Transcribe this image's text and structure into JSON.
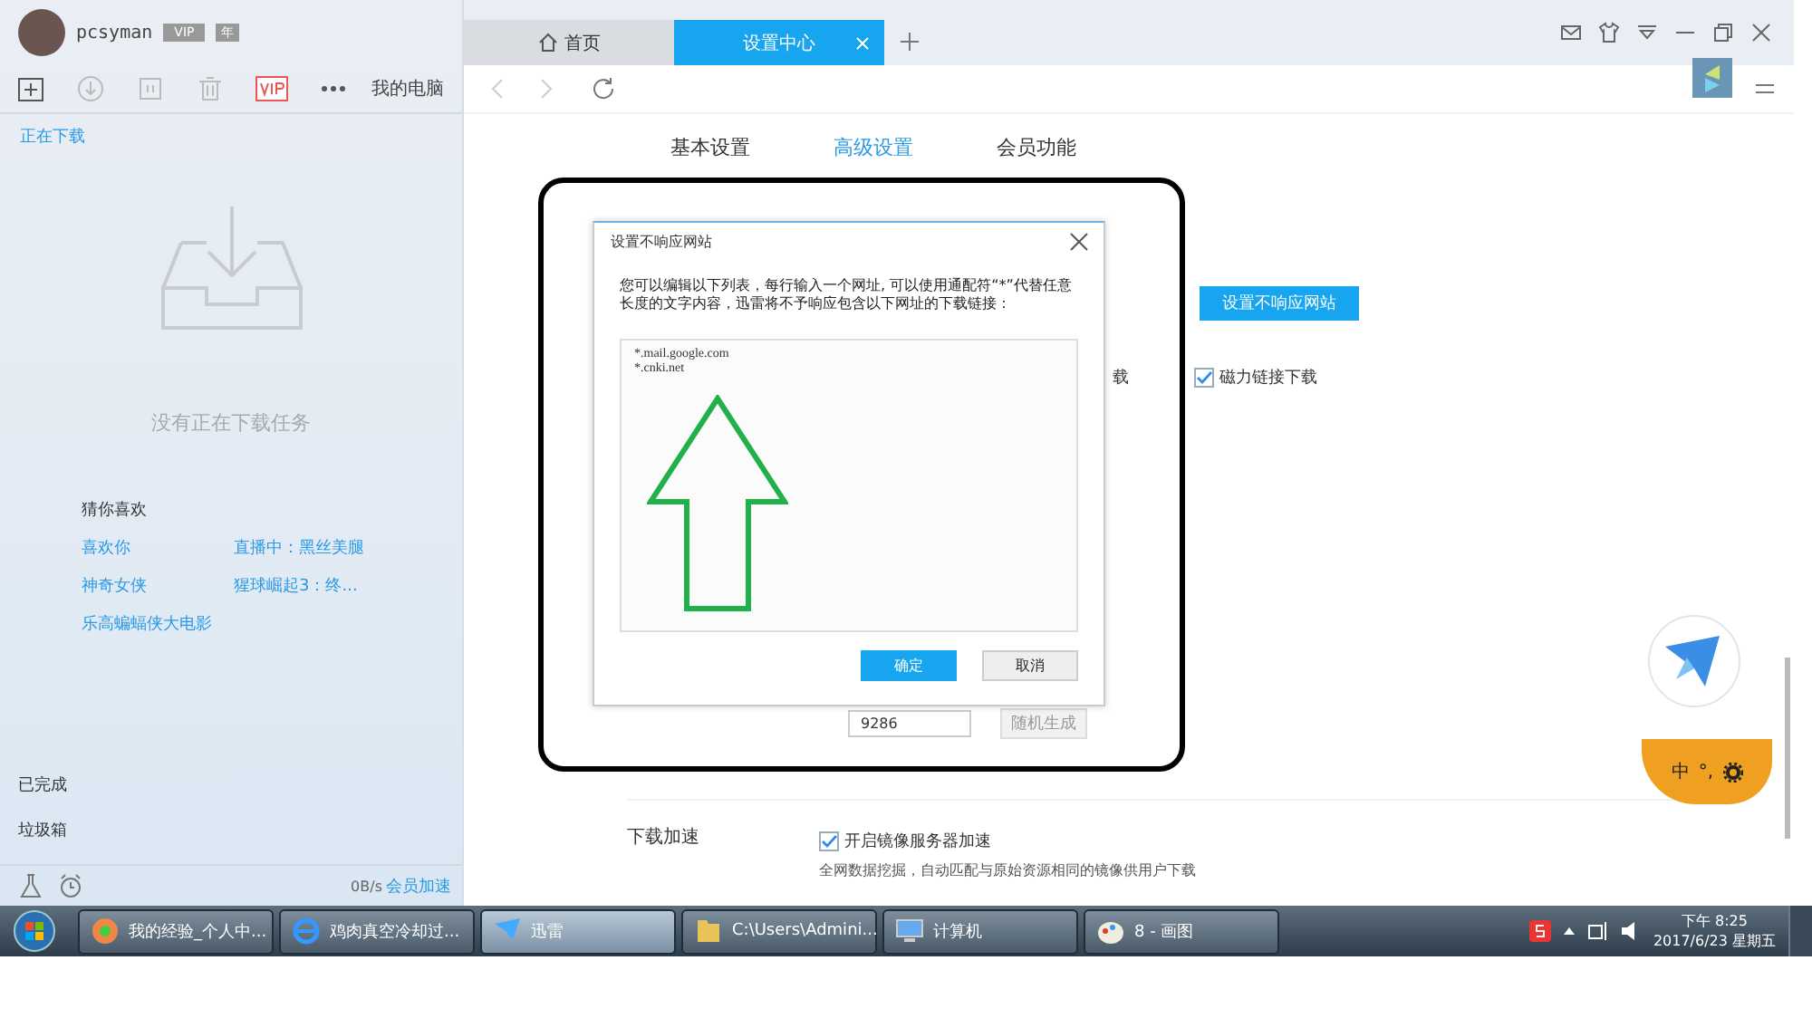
{
  "user": {
    "name": "pcsyman",
    "badges": [
      "VIP",
      "年"
    ]
  },
  "toolbar": {
    "device": "我的电脑"
  },
  "tabs": [
    {
      "label": "首页",
      "selected": false,
      "kind": "home"
    },
    {
      "label": "设置中心",
      "selected": true,
      "kind": "page"
    }
  ],
  "sidebar": {
    "section": "正在下载",
    "empty_text": "没有正在下载任务",
    "recommend_title": "猜你喜欢",
    "recommend": [
      "喜欢你",
      "直播中：黑丝美腿",
      "神奇女侠",
      "猩球崛起3：终...",
      "乐高蝙蝠侠大电影"
    ],
    "bottom_items": [
      "已完成",
      "垃圾箱"
    ],
    "speed": "0B/s",
    "boost_link": "会员加速"
  },
  "settings_tabs": [
    {
      "label": "基本设置",
      "selected": false
    },
    {
      "label": "高级设置",
      "selected": true
    },
    {
      "label": "会员功能",
      "selected": false
    }
  ],
  "settings": {
    "unresponsive_button": "设置不响应网站",
    "partial_label": "载",
    "magnet": {
      "label": "磁力链接下载",
      "checked": true
    },
    "port_value": "9286",
    "random_button": "随机生成",
    "accelerate": {
      "section": "下载加速",
      "label": "开启镜像服务器加速",
      "checked": true,
      "description": "全网数据挖掘，自动匹配与原始资源相同的镜像供用户下载"
    }
  },
  "dialog": {
    "title": "设置不响应网站",
    "instructions": "您可以编辑以下列表，每行输入一个网址, 可以使用通配符“*”代替任意长度的文字内容，迅雷将不予响应包含以下网址的下载链接：",
    "sites": [
      "*.mail.google.com",
      "*.cnki.net"
    ],
    "buttons": [
      {
        "label": "确定",
        "primary": true
      },
      {
        "label": "取消",
        "primary": false
      }
    ]
  },
  "ime": {
    "label": "中",
    "punct": "°,"
  },
  "taskbar": {
    "items": [
      {
        "label": "我的经验_个人中...",
        "selected": false
      },
      {
        "label": "鸡肉真空冷却过...",
        "selected": false
      },
      {
        "label": "迅雷",
        "selected": true
      },
      {
        "label": "C:\\Users\\Admini...",
        "selected": false
      },
      {
        "label": "计算机",
        "selected": false
      },
      {
        "label": "8 - 画图",
        "selected": false
      }
    ],
    "time": "下午 8:25",
    "date": "2017/6/23 星期五"
  }
}
